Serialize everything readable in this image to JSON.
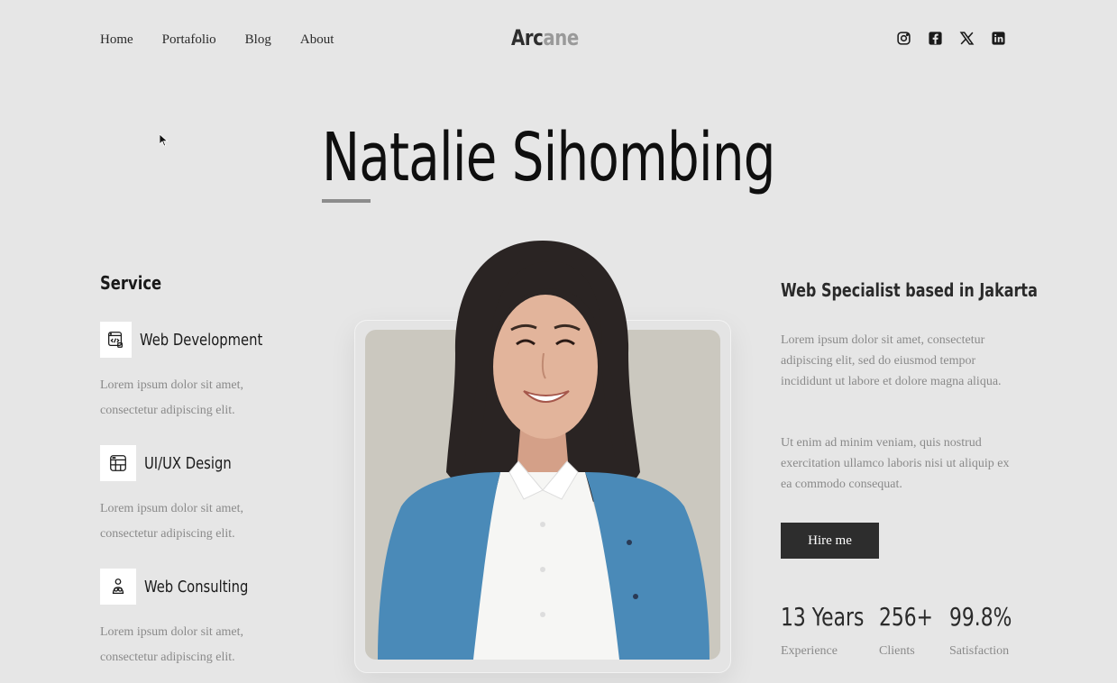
{
  "nav": {
    "items": [
      "Home",
      "Portafolio",
      "Blog",
      "About"
    ]
  },
  "brand": {
    "part1": "Arc",
    "part2": "ane"
  },
  "socials": [
    "instagram-icon",
    "facebook-icon",
    "x-icon",
    "linkedin-icon"
  ],
  "hero": {
    "name": "Natalie Sihombing"
  },
  "services": {
    "heading": "Service",
    "items": [
      {
        "icon": "code-window-icon",
        "title": "Web Development",
        "desc": "Lorem ipsum dolor sit amet, consectetur adipiscing elit."
      },
      {
        "icon": "layout-grid-icon",
        "title": "UI/UX Design",
        "desc": "Lorem ipsum dolor sit amet, consectetur adipiscing elit."
      },
      {
        "icon": "consulting-person-icon",
        "title": "Web Consulting",
        "desc": "Lorem ipsum dolor sit amet, consectetur adipiscing elit."
      }
    ]
  },
  "about": {
    "heading": "Web Specialist based in Jakarta",
    "p1": "Lorem ipsum dolor sit amet, consectetur adipiscing elit, sed do eiusmod tempor incididunt ut labore et dolore magna aliqua.",
    "p2": "Ut enim ad minim veniam, quis nostrud exercitation ullamco laboris nisi ut aliquip ex ea commodo consequat.",
    "cta": "Hire me"
  },
  "stats": [
    {
      "value": "13 Years",
      "label": "Experience"
    },
    {
      "value": "256+",
      "label": "Clients"
    },
    {
      "value": "99.8%",
      "label": "Satisfaction"
    }
  ],
  "colors": {
    "background": "#e6e6e6",
    "button": "#2d2d2d",
    "photo_bg": "#cbc8bf",
    "cardigan": "#4a8ab8"
  }
}
